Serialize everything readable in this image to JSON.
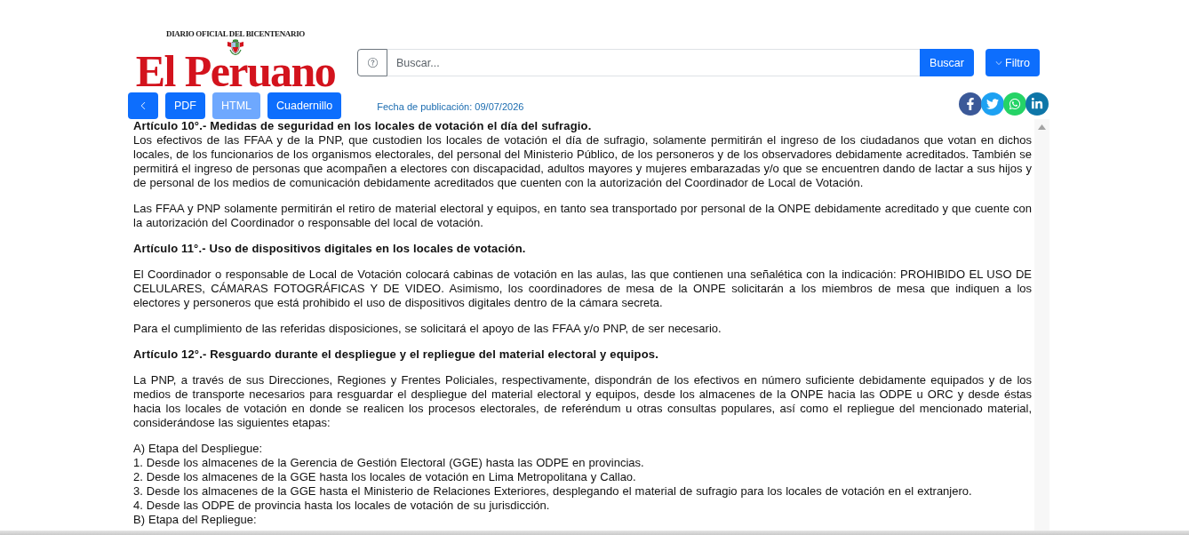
{
  "masthead": {
    "tagline": "DIARIO OFICIAL DEL BICENTENARIO",
    "title": "El Peruano"
  },
  "search": {
    "placeholder": "Buscar...",
    "button": "Buscar"
  },
  "filter": {
    "label": "Filtro"
  },
  "view_buttons": [
    {
      "label": "PDF",
      "selected": false
    },
    {
      "label": "HTML",
      "selected": true
    },
    {
      "label": "Cuadernillo",
      "selected": false
    }
  ],
  "publication_date": "Fecha de publicación: 09/07/2026",
  "share_links": [
    {
      "kind": "facebook",
      "color": "#3b5998"
    },
    {
      "kind": "twitter",
      "color": "#1da1f2"
    },
    {
      "kind": "whatsapp",
      "color": "#25d366"
    },
    {
      "kind": "linkedin",
      "color": "#0e76a8"
    }
  ],
  "article": {
    "blocks": [
      {
        "kind": "titled_paragraph",
        "title": "Artículo 10°.- Medidas de seguridad en los locales de votación el día del sufragio.",
        "text": "Los efectivos de las FFAA y de la PNP, que custodien los locales de votación el día de sufragio, solamente permitirán el ingreso de los ciudadanos que votan en dichos locales, de los funcionarios de los organismos electorales, del personal del Ministerio Público, de los personeros y de los observadores debidamente acreditados. También se permitirá el ingreso de personas que acompañen a electores con discapacidad, adultos mayores y mujeres embarazadas y/o que se encuentren dando de lactar a sus hijos y de personal de los medios de comunicación debidamente acreditados que cuenten con la autorización del Coordinador de Local de Votación."
      },
      {
        "kind": "paragraph",
        "text": "Las FFAA y PNP solamente permitirán el retiro de material electoral y equipos, en tanto sea transportado por personal de la ONPE debidamente acreditado y que cuente con la autorización del Coordinador o responsable del local de votación."
      },
      {
        "kind": "heading",
        "text": "Artículo 11°.- Uso de dispositivos digitales en los locales de votación."
      },
      {
        "kind": "paragraph",
        "text": "El Coordinador o responsable de Local de Votación colocará cabinas de votación en las aulas, las que contienen una señalética con la indicación: PROHIBIDO EL USO DE CELULARES, CÁMARAS FOTOGRÁFICAS Y DE VIDEO. Asimismo, los coordinadores de mesa de la ONPE solicitarán a los miembros de mesa que indiquen a los electores y personeros que está prohibido el uso de dispositivos digitales dentro de la cámara secreta."
      },
      {
        "kind": "paragraph",
        "text": "Para el cumplimiento de las referidas disposiciones, se solicitará el apoyo de las FFAA y/o PNP, de ser necesario."
      },
      {
        "kind": "heading",
        "text": "Artículo 12°.- Resguardo durante el despliegue y el repliegue del material electoral y equipos."
      },
      {
        "kind": "paragraph",
        "text": "La PNP, a través de sus Direcciones, Regiones y Frentes Policiales, respectivamente, dispondrán de los efectivos en número suficiente debidamente equipados y de los medios de transporte necesarios para resguardar el despliegue del material electoral y equipos, desde los almacenes de la ONPE hacia las ODPE u ORC y desde éstas hacia los locales de votación en donde se realicen los procesos electorales, de referéndum u otras consultas populares, así como el repliegue del mencionado material, considerándose las siguientes etapas:"
      },
      {
        "kind": "lines",
        "lines": [
          "A) Etapa del Despliegue:",
          "1. Desde los almacenes de la Gerencia de Gestión Electoral (GGE) hasta las ODPE en provincias.",
          "2. Desde los almacenes de la GGE hasta los locales de votación en Lima Metropolitana y Callao.",
          "3. Desde los almacenes de la GGE hasta el Ministerio de Relaciones Exteriores, desplegando el material de sufragio para los locales de votación en el extranjero.",
          "4. Desde las ODPE de provincia hasta los locales de votación de su jurisdicción.",
          "B) Etapa del Repliegue:"
        ]
      }
    ]
  }
}
